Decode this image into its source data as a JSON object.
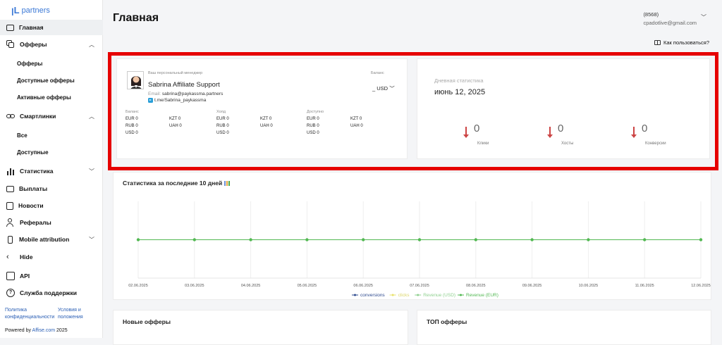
{
  "logo": {
    "text": "partners"
  },
  "nav": {
    "main": "Главная",
    "offers": "Офферы",
    "offers_sub": [
      "Офферы",
      "Доступные офферы",
      "Активные офферы"
    ],
    "smartlinks": "Смартлинки",
    "smartlinks_sub": [
      "Все",
      "Доступные"
    ],
    "statistics": "Статистика",
    "payouts": "Выплаты",
    "news": "Новости",
    "referrals": "Рефералы",
    "mobile": "Mobile attribution",
    "hide": "Hide",
    "api": "API",
    "support": "Служба поддержки"
  },
  "footer": {
    "privacy": "Политика конфиденциальности",
    "terms": "Условия и положения",
    "powered_prefix": "Powered by ",
    "powered_brand": "Affise.com",
    "powered_year": " 2025"
  },
  "header": {
    "title": "Главная",
    "user_id": "(8568)",
    "user_email": "cpadotlive@gmail.com",
    "howto": "Как пользоваться?"
  },
  "manager": {
    "caption": "Ваш персональный менеджер",
    "name": "Sabrina Affiliate Support",
    "email_label": "Email: ",
    "email": "sabrina@paykassma.partners",
    "telegram": "t.me/Sabrina_paykassma",
    "balance_caption": "Баланс",
    "balance_value": "_ USD",
    "columns": [
      {
        "header": "Баланс",
        "left": [
          "EUR 0",
          "RUB 0",
          "USD 0"
        ],
        "right": [
          "KZT 0",
          "UAH 0"
        ]
      },
      {
        "header": "Холд",
        "left": [
          "EUR 0",
          "RUB 0",
          "USD 0"
        ],
        "right": [
          "KZT 0",
          "UAH 0"
        ]
      },
      {
        "header": "Доступно",
        "left": [
          "EUR 0",
          "RUB 0",
          "USD 0"
        ],
        "right": [
          "KZT 0",
          "UAH 0"
        ]
      }
    ]
  },
  "daily": {
    "caption": "Дневная статистика",
    "date": "июнь 12, 2025",
    "stats": [
      {
        "value": "0",
        "label": "Клики"
      },
      {
        "value": "0",
        "label": "Хосты"
      },
      {
        "value": "0",
        "label": "Конверсии"
      }
    ]
  },
  "chart_card": {
    "title": "Статистика за последние 10 дней"
  },
  "chart_data": {
    "type": "line",
    "x": [
      "02.06.2025",
      "03.06.2025",
      "04.06.2025",
      "05.06.2025",
      "06.06.2025",
      "07.06.2025",
      "08.06.2025",
      "09.06.2025",
      "10.06.2025",
      "11.06.2025",
      "12.06.2025"
    ],
    "series": [
      {
        "name": "conversions",
        "values": [
          0,
          0,
          0,
          0,
          0,
          0,
          0,
          0,
          0,
          0,
          0
        ],
        "color": "#2f4b8f"
      },
      {
        "name": "clicks",
        "values": [
          0,
          0,
          0,
          0,
          0,
          0,
          0,
          0,
          0,
          0,
          0
        ],
        "color": "#e8e26a"
      },
      {
        "name": "Revenue (USD)",
        "values": [
          0,
          0,
          0,
          0,
          0,
          0,
          0,
          0,
          0,
          0,
          0
        ],
        "color": "#8fd08f"
      },
      {
        "name": "Revenue (EUR)",
        "values": [
          0,
          0,
          0,
          0,
          0,
          0,
          0,
          0,
          0,
          0,
          0
        ],
        "color": "#52b852"
      }
    ],
    "grid": true,
    "legend": "bottom"
  },
  "bottom": {
    "new_offers": "Новые офферы",
    "top_offers": "ТОП офферы"
  }
}
